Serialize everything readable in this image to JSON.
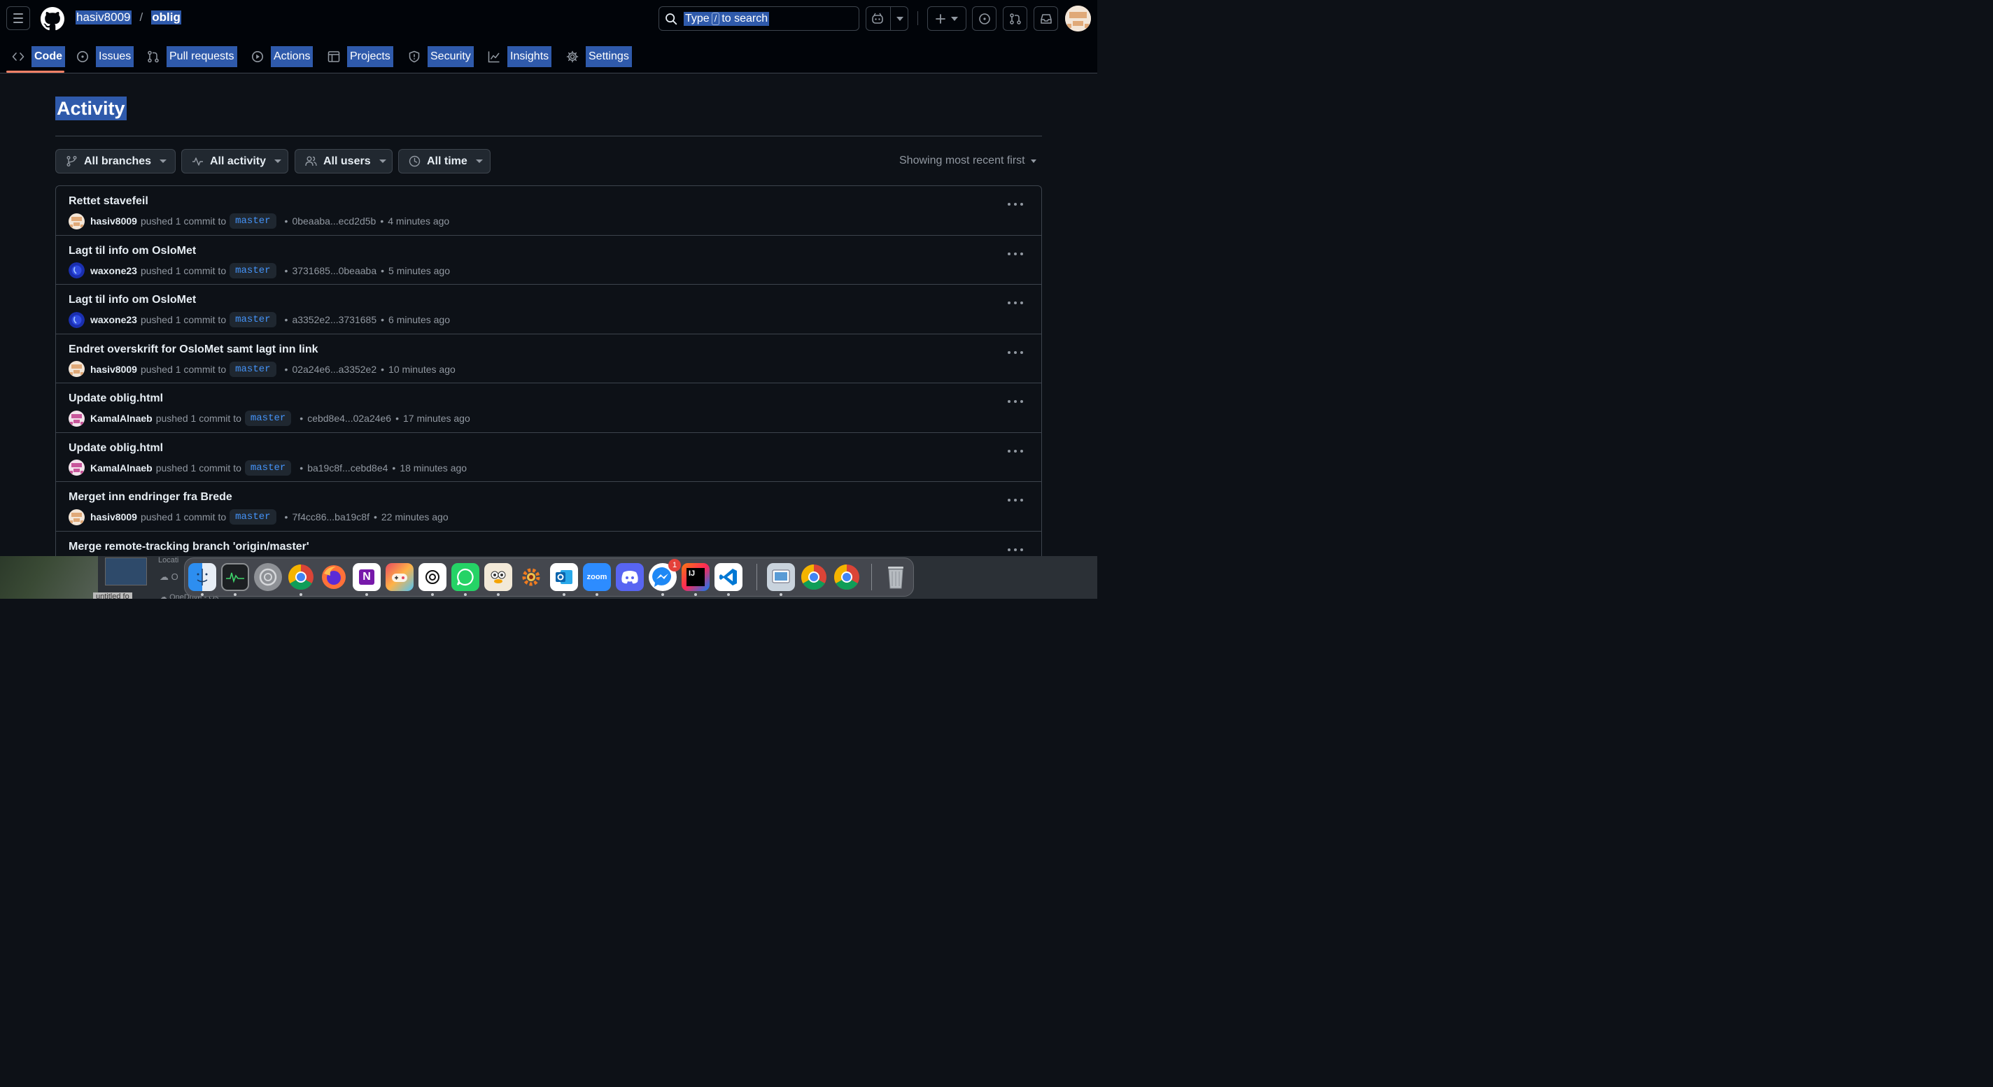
{
  "header": {
    "owner": "hasiv8009",
    "separator": "/",
    "repo": "oblig",
    "search": {
      "prefix": "Type",
      "key": "/",
      "suffix": "to search"
    }
  },
  "tabs": [
    {
      "label": "Code",
      "icon": "code-icon",
      "active": true
    },
    {
      "label": "Issues",
      "icon": "issue-opened-icon"
    },
    {
      "label": "Pull requests",
      "icon": "git-pull-request-icon"
    },
    {
      "label": "Actions",
      "icon": "play-icon"
    },
    {
      "label": "Projects",
      "icon": "table-icon"
    },
    {
      "label": "Security",
      "icon": "shield-icon"
    },
    {
      "label": "Insights",
      "icon": "graph-icon"
    },
    {
      "label": "Settings",
      "icon": "gear-icon"
    }
  ],
  "page_title": "Activity",
  "filters": [
    {
      "label": "All branches",
      "icon": "git-branch-icon"
    },
    {
      "label": "All activity",
      "icon": "pulse-icon"
    },
    {
      "label": "All users",
      "icon": "people-icon"
    },
    {
      "label": "All time",
      "icon": "clock-icon"
    }
  ],
  "sort_label": "Showing most recent first",
  "activity": [
    {
      "title": "Rettet stavefeil",
      "user": "hasiv8009",
      "action": "pushed 1 commit to",
      "branch": "master",
      "range": "0beaaba...ecd2d5b",
      "time": "4 minutes ago"
    },
    {
      "title": "Lagt til info om OsloMet",
      "user": "waxone23",
      "action": "pushed 1 commit to",
      "branch": "master",
      "range": "3731685...0beaaba",
      "time": "5 minutes ago"
    },
    {
      "title": "Lagt til info om OsloMet",
      "user": "waxone23",
      "action": "pushed 1 commit to",
      "branch": "master",
      "range": "a3352e2...3731685",
      "time": "6 minutes ago"
    },
    {
      "title": "Endret overskrift for OsloMet samt lagt inn link",
      "user": "hasiv8009",
      "action": "pushed 1 commit to",
      "branch": "master",
      "range": "02a24e6...a3352e2",
      "time": "10 minutes ago"
    },
    {
      "title": "Update oblig.html",
      "user": "KamalAlnaeb",
      "action": "pushed 1 commit to",
      "branch": "master",
      "range": "cebd8e4...02a24e6",
      "time": "17 minutes ago"
    },
    {
      "title": "Update oblig.html",
      "user": "KamalAlnaeb",
      "action": "pushed 1 commit to",
      "branch": "master",
      "range": "ba19c8f...cebd8e4",
      "time": "18 minutes ago"
    },
    {
      "title": "Merget inn endringer fra Brede",
      "user": "hasiv8009",
      "action": "pushed 1 commit to",
      "branch": "master",
      "range": "7f4cc86...ba19c8f",
      "time": "22 minutes ago"
    },
    {
      "title": "Merge remote-tracking branch 'origin/master'",
      "user": "",
      "action": "",
      "branch": "",
      "range": "",
      "time": ""
    }
  ],
  "desktop": {
    "location_label": "Locati",
    "row1": "O",
    "row2": "OneDrive - Os",
    "file_label": "untitled fo"
  },
  "dock": {
    "apps": [
      "Finder",
      "Activity Monitor",
      "System Settings",
      "Google Chrome",
      "Firefox",
      "OneNote",
      "Games",
      "ChatGPT",
      "WhatsApp",
      "Cyberduck",
      "Disk Diag",
      "Outlook",
      "Zoom",
      "Discord",
      "Messenger",
      "IntelliJ IDEA",
      "Visual Studio Code",
      "Preview",
      "Google Chrome 2",
      "Google Chrome 3",
      "Trash"
    ],
    "zoom_label": "zoom",
    "onenote_label": "N",
    "intellij_label": "IJ",
    "messenger_badge": "1"
  }
}
